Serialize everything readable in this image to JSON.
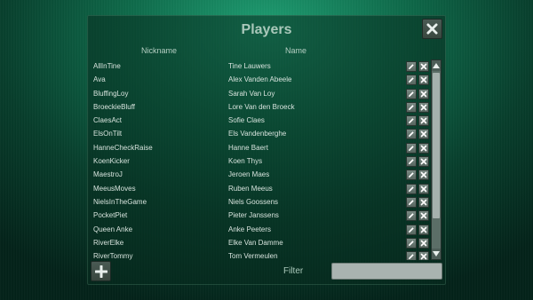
{
  "dialog": {
    "title": "Players",
    "columns": {
      "nickname": "Nickname",
      "name": "Name"
    },
    "filter_label": "Filter",
    "filter_value": "",
    "close_icon": "close-icon",
    "add_icon": "plus-icon",
    "edit_icon": "pencil-icon",
    "delete_icon": "x-icon"
  },
  "players": [
    {
      "nickname": "AllInTine",
      "name": "Tine Lauwers"
    },
    {
      "nickname": "Ava",
      "name": "Alex Vanden Abeele"
    },
    {
      "nickname": "BluffingLoy",
      "name": "Sarah Van Loy"
    },
    {
      "nickname": "BroeckieBluff",
      "name": "Lore Van den Broeck"
    },
    {
      "nickname": "ClaesAct",
      "name": "Sofie Claes"
    },
    {
      "nickname": "ElsOnTilt",
      "name": "Els Vandenberghe"
    },
    {
      "nickname": "HanneCheckRaise",
      "name": "Hanne Baert"
    },
    {
      "nickname": "KoenKicker",
      "name": "Koen Thys"
    },
    {
      "nickname": "MaestroJ",
      "name": "Jeroen Maes"
    },
    {
      "nickname": "MeeusMoves",
      "name": "Ruben Meeus"
    },
    {
      "nickname": "NielsInTheGame",
      "name": "Niels Goossens"
    },
    {
      "nickname": "PocketPiet",
      "name": "Pieter Janssens"
    },
    {
      "nickname": "Queen Anke",
      "name": "Anke Peeters"
    },
    {
      "nickname": "RiverElke",
      "name": "Elke Van Damme"
    },
    {
      "nickname": "RiverTommy",
      "name": "Tom Vermeulen"
    }
  ]
}
